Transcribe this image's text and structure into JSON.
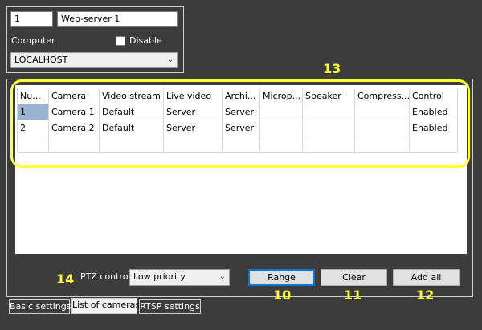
{
  "server": {
    "id": "1",
    "name": "Web-server 1",
    "computer_label": "Computer",
    "disable_label": "Disable",
    "computer_value": "LOCALHOST"
  },
  "cameras": {
    "headers": [
      "Nu...",
      "Camera",
      "Video stream",
      "Live video",
      "Archi...",
      "Microp...",
      "Speaker",
      "Compress...",
      "Control"
    ],
    "rows": [
      [
        "1",
        "Camera 1",
        "Default",
        "Server",
        "Server",
        "",
        "",
        "",
        "Enabled"
      ],
      [
        "2",
        "Camera 2",
        "Default",
        "Server",
        "Server",
        "",
        "",
        "",
        "Enabled"
      ]
    ]
  },
  "ptz": {
    "label": "PTZ control",
    "value": "Low priority"
  },
  "buttons": {
    "range": "Range",
    "clear": "Clear",
    "add_all": "Add all"
  },
  "tabs": [
    "Basic settings",
    "List of cameras",
    "RTSP settings"
  ],
  "annotations": {
    "n10": "10",
    "n11": "11",
    "n12": "12",
    "n13": "13",
    "n14": "14"
  },
  "colors": {
    "annotation": "#ffff33",
    "background": "#3c3c3c",
    "selection": "#99b4d1"
  }
}
